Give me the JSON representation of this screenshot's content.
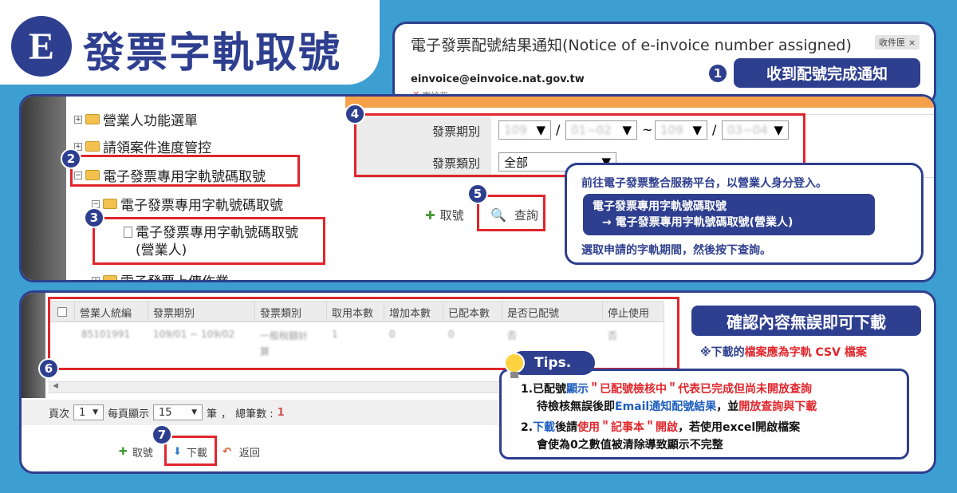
{
  "header": {
    "logo_letter": "E",
    "title": "發票字軌取號"
  },
  "email": {
    "subject": "電子發票配號結果通知(Notice of e-invoice number assigned)",
    "inbox_tag": "收件匣",
    "inbox_close": "×",
    "sender": "einvoice@einvoice.nat.gov.tw",
    "to_label": "寄給我",
    "badge": "1",
    "notice_label": "收到配號完成通知"
  },
  "tree": {
    "items": [
      "營業人功能選單",
      "請領案件進度管控",
      "電子發票專用字軌號碼取號",
      "電子發票專用字軌號碼取號",
      "電子發票專用字軌號碼取號",
      "(營業人)",
      "電子發票上傳作業"
    ],
    "badge2": "2",
    "badge3": "3"
  },
  "form": {
    "badge4": "4",
    "period_label": "發票期別",
    "year1": "109",
    "months1": "01~02",
    "tilde": "~",
    "slash": "/",
    "year2": "109",
    "months2": "03~04",
    "type_label": "發票類別",
    "type_value": "全部",
    "badge5": "5",
    "take_label": "取號",
    "query_label": "查詢"
  },
  "instruction": {
    "line1": "前往電子發票整合服務平台，以營業人身分登入。",
    "path1": "電子發票專用字軌號碼取號",
    "path2": "→ 電子發票專用字軌號碼取號(營業人)",
    "line2": "選取申請的字軌期間，然後按下查詢。"
  },
  "table": {
    "headers": [
      "營業人統編",
      "發票期別",
      "發票類別",
      "取用本數",
      "增加本數",
      "已配本數",
      "是否已配號",
      "停止使用"
    ],
    "row": [
      "85101991",
      "109/01 ~ 109/02",
      "一般稅額計",
      "1",
      "0",
      "0",
      "否",
      "否"
    ],
    "row_extra": "算",
    "badge6": "6"
  },
  "pager": {
    "page_label": "頁次",
    "page_value": "1",
    "per_page_label": "每頁顯示",
    "per_page_value": "15",
    "unit": "筆",
    "sep": "，",
    "total_label": "總筆數 :",
    "total_value": "1"
  },
  "actions": {
    "badge7": "7",
    "take_label": "取號",
    "download_label": "下載",
    "back_label": "返回"
  },
  "confirm": {
    "title": "確認內容無誤即可下載",
    "note_prefix": "※下載的",
    "note_highlight": "檔案應為字軌 CSV 檔案"
  },
  "tips": {
    "title": "Tips.",
    "t1_a": "1.已配號",
    "t1_b": "顯示",
    "t1_c": "＂已配號檢核中＂",
    "t1_d": "代表已完成但尚未開放查詢",
    "t1_e": "待檢核無誤後即",
    "t1_f": "Email通知配號結果",
    "t1_g": "，並",
    "t1_h": "開放查詢與下載",
    "t2_a": "2.",
    "t2_b": "下載",
    "t2_c": "後請",
    "t2_d": "使用＂記事本＂開啟",
    "t2_e": "，若使用excel開啟檔案",
    "t2_f": "會使為0之數值被清除導致顯示不完整"
  },
  "colors": {
    "navy": "#2e3f8f",
    "red": "#e0262c",
    "bg": "#3d9fd1",
    "blue_text": "#1f5fbf"
  }
}
